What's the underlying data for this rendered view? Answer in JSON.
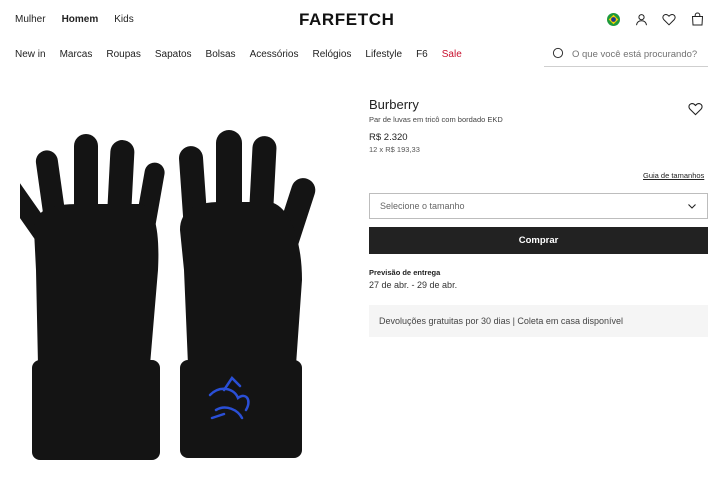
{
  "header": {
    "gender_tabs": [
      {
        "label": "Mulher",
        "active": false
      },
      {
        "label": "Homem",
        "active": true
      },
      {
        "label": "Kids",
        "active": false
      }
    ],
    "logo": "FARFETCH",
    "icons": [
      "brazil-flag-icon",
      "account-icon",
      "wishlist-heart-icon",
      "shopping-bag-icon"
    ]
  },
  "nav": {
    "categories": [
      "New in",
      "Marcas",
      "Roupas",
      "Sapatos",
      "Bolsas",
      "Acessórios",
      "Relógios",
      "Lifestyle",
      "F6",
      "Sale"
    ],
    "sale_color": "#c8102e"
  },
  "search": {
    "placeholder": "O que você está procurando?"
  },
  "product": {
    "brand": "Burberry",
    "name": "Par de luvas em tricô com bordado EKD",
    "price": "R$ 2.320",
    "installments": "12 x R$ 193,33",
    "size_guide": "Guia de tamanhos",
    "size_select_placeholder": "Selecione o tamanho",
    "buy_label": "Comprar",
    "delivery_label": "Previsão de entrega",
    "delivery_dates": "27 de abr. - 29 de abr.",
    "returns_info": "Devoluções gratuitas por 30 dias | Coleta em casa disponível",
    "image": "black knitted gloves with blue EKD embroidery"
  },
  "colors": {
    "primary_button": "#222222",
    "embroidery_blue": "#2a4fd6",
    "glove_black": "#141414"
  }
}
